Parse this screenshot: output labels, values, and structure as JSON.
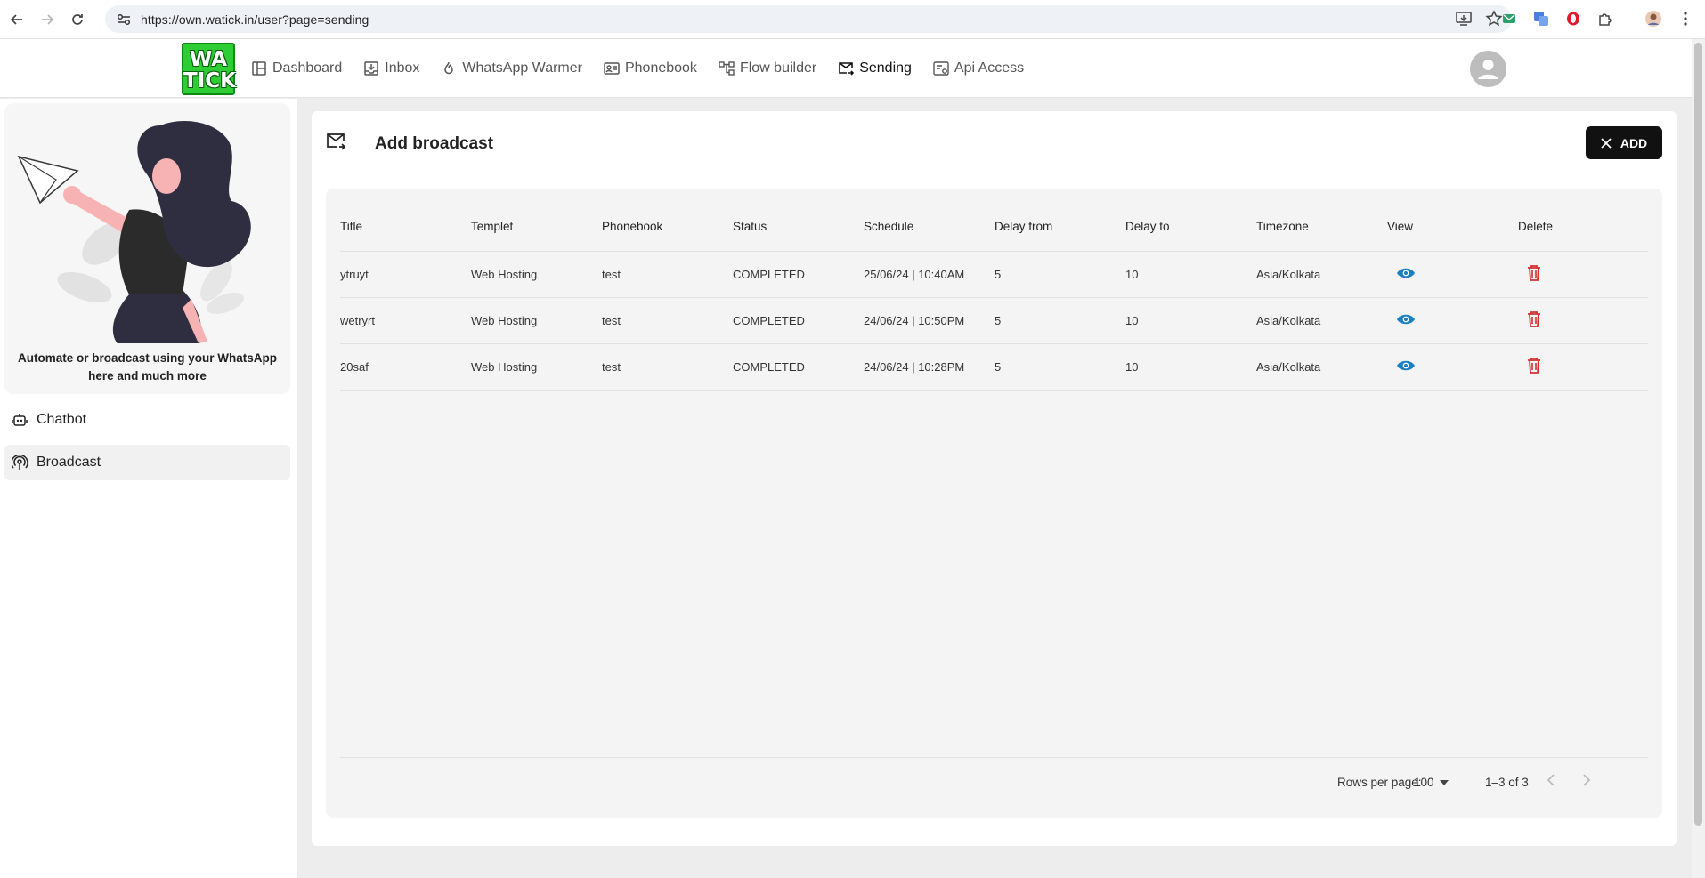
{
  "browser": {
    "url": "https://own.watick.in/user?page=sending"
  },
  "header": {
    "logo_line1": "WA",
    "logo_line2": "TICK",
    "nav": [
      {
        "label": "Dashboard",
        "icon": "dashboard-icon"
      },
      {
        "label": "Inbox",
        "icon": "inbox-icon"
      },
      {
        "label": "WhatsApp Warmer",
        "icon": "fire-icon"
      },
      {
        "label": "Phonebook",
        "icon": "contacts-icon"
      },
      {
        "label": "Flow builder",
        "icon": "flow-icon"
      },
      {
        "label": "Sending",
        "icon": "mail-send-icon",
        "active": true
      },
      {
        "label": "Api Access",
        "icon": "api-icon"
      }
    ]
  },
  "sidebar": {
    "promo_text": "Automate or broadcast using your WhatsApp here and much more",
    "items": [
      {
        "label": "Chatbot",
        "icon": "robot-icon"
      },
      {
        "label": "Broadcast",
        "icon": "broadcast-icon",
        "active": true
      }
    ]
  },
  "main": {
    "title": "Add broadcast",
    "add_label": "ADD",
    "columns": [
      "Title",
      "Templet",
      "Phonebook",
      "Status",
      "Schedule",
      "Delay from",
      "Delay to",
      "Timezone",
      "View",
      "Delete"
    ],
    "rows": [
      {
        "title": "ytruyt",
        "templet": "Web Hosting",
        "phonebook": "test",
        "status": "COMPLETED",
        "schedule": "25/06/24 | 10:40AM",
        "delay_from": "5",
        "delay_to": "10",
        "timezone": "Asia/Kolkata"
      },
      {
        "title": "wetryrt",
        "templet": "Web Hosting",
        "phonebook": "test",
        "status": "COMPLETED",
        "schedule": "24/06/24 | 10:50PM",
        "delay_from": "5",
        "delay_to": "10",
        "timezone": "Asia/Kolkata"
      },
      {
        "title": "20saf",
        "templet": "Web Hosting",
        "phonebook": "test",
        "status": "COMPLETED",
        "schedule": "24/06/24 | 10:28PM",
        "delay_from": "5",
        "delay_to": "10",
        "timezone": "Asia/Kolkata"
      }
    ],
    "footer": {
      "rows_per_page_label": "Rows per page:",
      "rows_per_page_value": "100",
      "range": "1–3 of 3"
    }
  },
  "colors": {
    "view_icon": "#1a7fc1",
    "delete_icon": "#d32f2f",
    "logo_green": "#2fcd35",
    "button_dark": "#111111"
  }
}
